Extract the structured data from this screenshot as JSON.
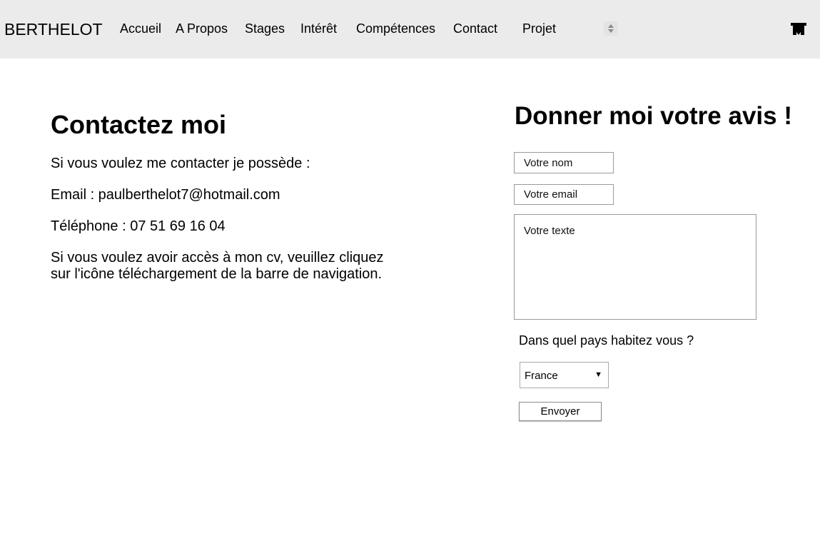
{
  "navbar": {
    "brand": "BERTHELOT",
    "items": [
      {
        "label": "Accueil"
      },
      {
        "label": "A Propos"
      },
      {
        "label": "Stages"
      },
      {
        "label": "Intérêt"
      },
      {
        "label": "Compétences"
      },
      {
        "label": "Contact"
      },
      {
        "label": "Projet"
      }
    ],
    "icons": [
      "sort-icon",
      "download-icon"
    ]
  },
  "contact": {
    "title": "Contactez moi",
    "intro": "Si vous voulez me contacter je possède :",
    "email": "Email : paulberthelot7@hotmail.com",
    "phone": "Téléphone : 07 51 69 16 04",
    "cv_note": "Si vous voulez avoir accès à mon cv, veuillez cliquez sur l'icône téléchargement de la barre de navigation."
  },
  "form": {
    "title": "Donner moi votre avis !",
    "name_placeholder": "Votre nom",
    "email_placeholder": "Votre email",
    "text_placeholder": "Votre texte",
    "country_question": "Dans quel pays habitez vous ?",
    "country_selected": "France",
    "submit_label": "Envoyer"
  },
  "colors": {
    "navbar_background": "#ebebeb",
    "page_background": "#ffffff",
    "text": "#000000"
  }
}
